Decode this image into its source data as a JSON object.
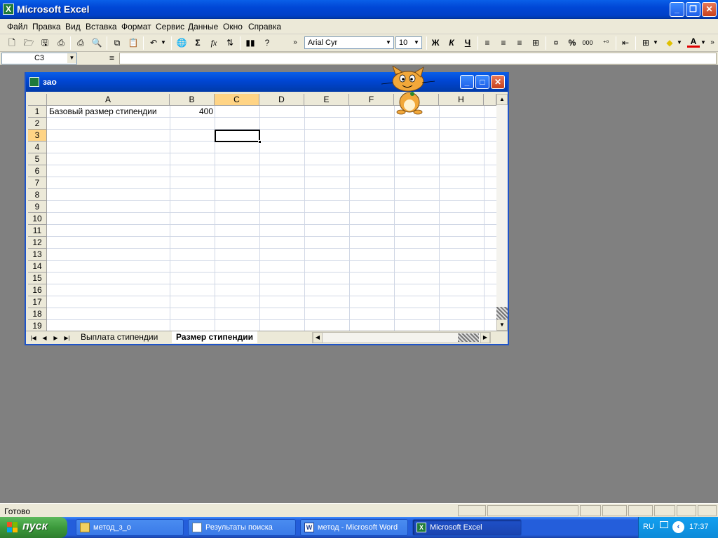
{
  "app": {
    "title": "Microsoft Excel"
  },
  "menu": [
    "Файл",
    "Правка",
    "Вид",
    "Вставка",
    "Формат",
    "Сервис",
    "Данные",
    "Окно",
    "Справка"
  ],
  "toolbar": {
    "font": "Arial Cyr",
    "size": "10",
    "bold": "Ж",
    "italic": "К",
    "underline": "Ч",
    "percent": "%",
    "thousands": "000",
    "sum": "Σ",
    "fx": "fx"
  },
  "formula": {
    "name_box": "C3",
    "equals": "=",
    "value": ""
  },
  "workbook": {
    "title": "зао",
    "columns": [
      "A",
      "B",
      "C",
      "D",
      "E",
      "F",
      "G",
      "H"
    ],
    "selected_column": "C",
    "rows": [
      "1",
      "2",
      "3",
      "4",
      "5",
      "6",
      "7",
      "8",
      "9",
      "10",
      "11",
      "12",
      "13",
      "14",
      "15",
      "16",
      "17",
      "18",
      "19"
    ],
    "selected_row": "3",
    "cells": {
      "A1": "Базовый размер стипендии",
      "B1": "400"
    },
    "selected_cell": "C3",
    "sheets": [
      "Выплата стипендии",
      "Размер стипендии"
    ],
    "active_sheet": "Размер стипендии"
  },
  "status": {
    "text": "Готово"
  },
  "taskbar": {
    "start": "пуск",
    "tasks": [
      "метод_з_о",
      "Результаты поиска",
      "метод - Microsoft Word",
      "Microsoft Excel"
    ],
    "active_task": "Microsoft Excel",
    "lang": "RU",
    "clock": "17:37"
  },
  "colors": {
    "titlebar": "#0047d6",
    "selected_header": "#ffd485",
    "gridline": "#d0d7e5",
    "taskbar": "#245edb",
    "start": "#3c9a3c"
  }
}
